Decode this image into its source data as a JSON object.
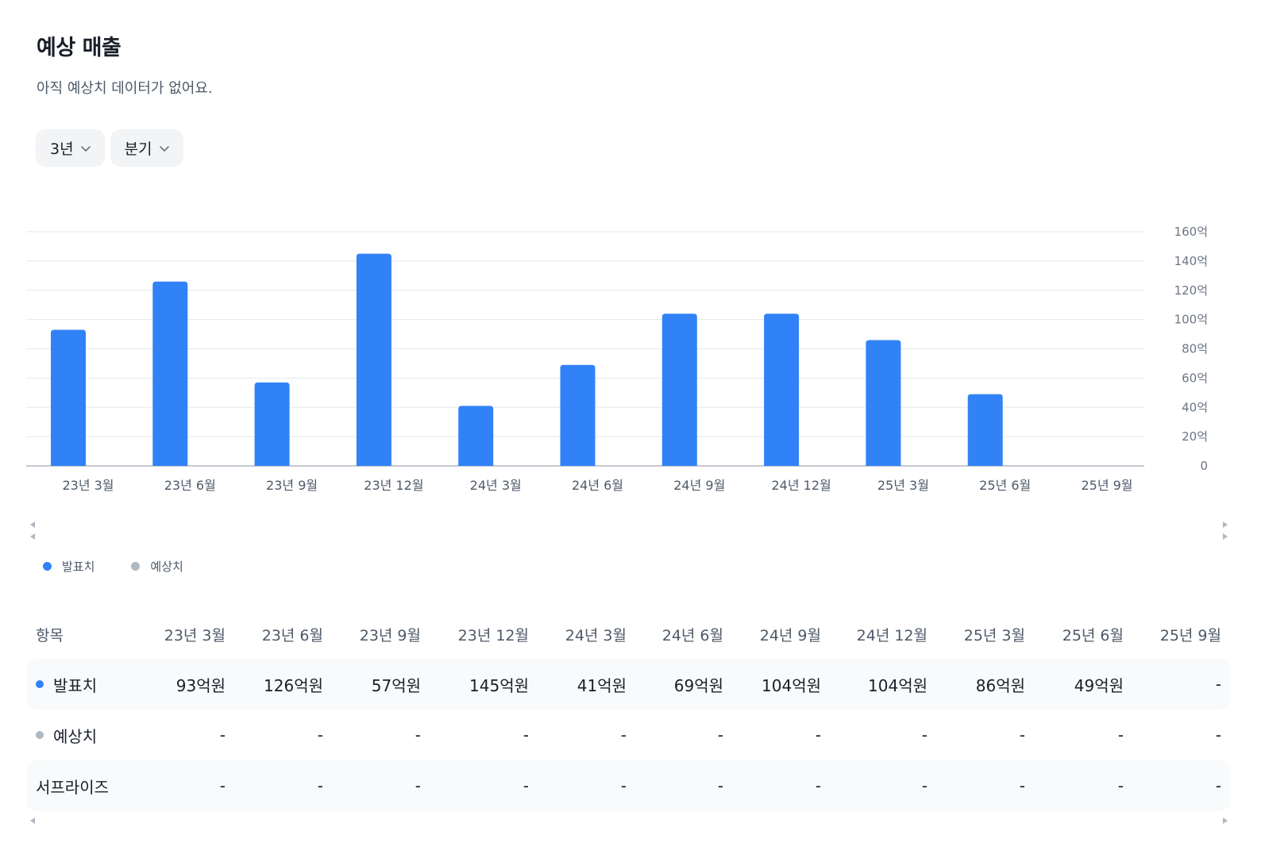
{
  "header": {
    "title": "예상 매출",
    "subtitle": "아직 예상치 데이터가 없어요."
  },
  "filters": [
    {
      "label": "3년"
    },
    {
      "label": "분기"
    }
  ],
  "colors": {
    "actual": "#3182f6",
    "estimate": "#b0b8c1",
    "grid": "#e5e8eb",
    "axis": "#b0b8c1",
    "tick_text": "#6b7684",
    "row_shade": "#f9fafb"
  },
  "chart_data": {
    "type": "bar",
    "categories": [
      "23년 3월",
      "23년 6월",
      "23년 9월",
      "23년 12월",
      "24년 3월",
      "24년 6월",
      "24년 9월",
      "24년 12월",
      "25년 3월",
      "25년 6월",
      "25년 9월"
    ],
    "series": [
      {
        "name": "발표치",
        "values": [
          93,
          126,
          57,
          145,
          41,
          69,
          104,
          104,
          86,
          49,
          null
        ]
      },
      {
        "name": "예상치",
        "values": [
          null,
          null,
          null,
          null,
          null,
          null,
          null,
          null,
          null,
          null,
          null
        ]
      }
    ],
    "y_ticks": [
      "0",
      "20억",
      "40억",
      "60억",
      "80억",
      "100억",
      "120억",
      "140억",
      "160억"
    ],
    "ylim": [
      0,
      160
    ],
    "y_axis_side": "right",
    "grid": true,
    "legend_position": "bottom-left"
  },
  "legend": [
    {
      "label": "발표치",
      "color": "#3182f6"
    },
    {
      "label": "예상치",
      "color": "#b0b8c1"
    }
  ],
  "table": {
    "header_label": "항목",
    "columns": [
      "23년 3월",
      "23년 6월",
      "23년 9월",
      "23년 12월",
      "24년 3월",
      "24년 6월",
      "24년 9월",
      "24년 12월",
      "25년 3월",
      "25년 6월",
      "25년 9월"
    ],
    "rows": [
      {
        "label": "발표치",
        "dot": "#3182f6",
        "values": [
          "93억원",
          "126억원",
          "57억원",
          "145억원",
          "41억원",
          "69억원",
          "104억원",
          "104억원",
          "86억원",
          "49억원",
          "-"
        ]
      },
      {
        "label": "예상치",
        "dot": "#b0b8c1",
        "values": [
          "-",
          "-",
          "-",
          "-",
          "-",
          "-",
          "-",
          "-",
          "-",
          "-",
          "-"
        ]
      },
      {
        "label": "서프라이즈",
        "dot": "",
        "values": [
          "-",
          "-",
          "-",
          "-",
          "-",
          "-",
          "-",
          "-",
          "-",
          "-",
          "-"
        ]
      }
    ]
  }
}
